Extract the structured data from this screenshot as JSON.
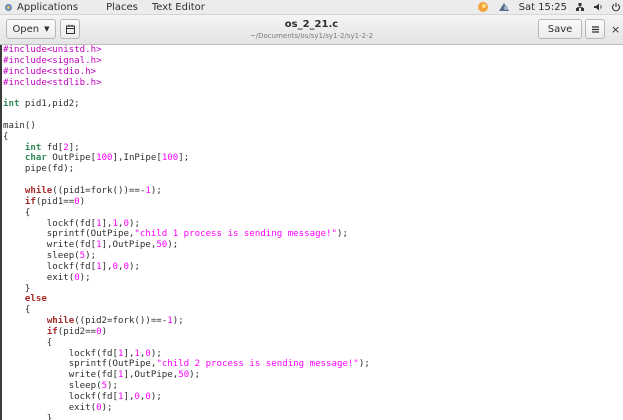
{
  "topbar": {
    "applications": "Applications",
    "places": "Places",
    "text_editor": "Text Editor",
    "clock": "Sat 15:25"
  },
  "header": {
    "open_label": "Open",
    "title": "os_2_21.c",
    "subtitle": "~/Documents/os/sy1/sy1-2/sy1-2-2",
    "save_label": "Save"
  },
  "icons": {
    "applications": "applications-icon",
    "weather": "weather-icon",
    "accessibility": "accessibility-icon",
    "network": "network-icon",
    "volume": "volume-icon",
    "power": "power-icon",
    "new_document": "new-document-icon",
    "menu": "hamburger-menu-icon",
    "close": "close-icon"
  },
  "colors": {
    "preprocessor": "#c000c0",
    "keyword": "#a52a2a",
    "type": "#2e8b57",
    "literal": "#ff00ff"
  },
  "code_lines": [
    [
      {
        "t": "pp",
        "v": "#include<unistd.h>"
      }
    ],
    [
      {
        "t": "pp",
        "v": "#include<signal.h>"
      }
    ],
    [
      {
        "t": "pp",
        "v": "#include<stdio.h>"
      }
    ],
    [
      {
        "t": "pp",
        "v": "#include<stdlib.h>"
      }
    ],
    [],
    [
      {
        "t": "ty",
        "v": "int"
      },
      {
        "t": "id",
        "v": " pid1,pid2;"
      }
    ],
    [],
    [
      {
        "t": "id",
        "v": "main()"
      }
    ],
    [
      {
        "t": "id",
        "v": "{"
      }
    ],
    [
      {
        "t": "id",
        "v": "    "
      },
      {
        "t": "ty",
        "v": "int"
      },
      {
        "t": "id",
        "v": " fd["
      },
      {
        "t": "num",
        "v": "2"
      },
      {
        "t": "id",
        "v": "];"
      }
    ],
    [
      {
        "t": "id",
        "v": "    "
      },
      {
        "t": "ty",
        "v": "char"
      },
      {
        "t": "id",
        "v": " OutPipe["
      },
      {
        "t": "num",
        "v": "100"
      },
      {
        "t": "id",
        "v": "],InPipe["
      },
      {
        "t": "num",
        "v": "100"
      },
      {
        "t": "id",
        "v": "];"
      }
    ],
    [
      {
        "t": "id",
        "v": "    pipe(fd);"
      }
    ],
    [],
    [
      {
        "t": "id",
        "v": "    "
      },
      {
        "t": "kw",
        "v": "while"
      },
      {
        "t": "id",
        "v": "((pid1=fork())==-"
      },
      {
        "t": "num",
        "v": "1"
      },
      {
        "t": "id",
        "v": ");"
      }
    ],
    [
      {
        "t": "id",
        "v": "    "
      },
      {
        "t": "kw",
        "v": "if"
      },
      {
        "t": "id",
        "v": "(pid1=="
      },
      {
        "t": "num",
        "v": "0"
      },
      {
        "t": "id",
        "v": ")"
      }
    ],
    [
      {
        "t": "id",
        "v": "    {"
      }
    ],
    [
      {
        "t": "id",
        "v": "        lockf(fd["
      },
      {
        "t": "num",
        "v": "1"
      },
      {
        "t": "id",
        "v": "],"
      },
      {
        "t": "num",
        "v": "1"
      },
      {
        "t": "id",
        "v": ","
      },
      {
        "t": "num",
        "v": "0"
      },
      {
        "t": "id",
        "v": ");"
      }
    ],
    [
      {
        "t": "id",
        "v": "        sprintf(OutPipe,"
      },
      {
        "t": "str",
        "v": "\"child 1 process is sending message!\""
      },
      {
        "t": "id",
        "v": ");"
      }
    ],
    [
      {
        "t": "id",
        "v": "        write(fd["
      },
      {
        "t": "num",
        "v": "1"
      },
      {
        "t": "id",
        "v": "],OutPipe,"
      },
      {
        "t": "num",
        "v": "50"
      },
      {
        "t": "id",
        "v": ");"
      }
    ],
    [
      {
        "t": "id",
        "v": "        sleep("
      },
      {
        "t": "num",
        "v": "5"
      },
      {
        "t": "id",
        "v": ");"
      }
    ],
    [
      {
        "t": "id",
        "v": "        lockf(fd["
      },
      {
        "t": "num",
        "v": "1"
      },
      {
        "t": "id",
        "v": "],"
      },
      {
        "t": "num",
        "v": "0"
      },
      {
        "t": "id",
        "v": ","
      },
      {
        "t": "num",
        "v": "0"
      },
      {
        "t": "id",
        "v": ");"
      }
    ],
    [
      {
        "t": "id",
        "v": "        exit("
      },
      {
        "t": "num",
        "v": "0"
      },
      {
        "t": "id",
        "v": ");"
      }
    ],
    [
      {
        "t": "id",
        "v": "    }"
      }
    ],
    [
      {
        "t": "id",
        "v": "    "
      },
      {
        "t": "kw",
        "v": "else"
      }
    ],
    [
      {
        "t": "id",
        "v": "    {"
      }
    ],
    [
      {
        "t": "id",
        "v": "        "
      },
      {
        "t": "kw",
        "v": "while"
      },
      {
        "t": "id",
        "v": "((pid2=fork())==-"
      },
      {
        "t": "num",
        "v": "1"
      },
      {
        "t": "id",
        "v": ");"
      }
    ],
    [
      {
        "t": "id",
        "v": "        "
      },
      {
        "t": "kw",
        "v": "if"
      },
      {
        "t": "id",
        "v": "(pid2=="
      },
      {
        "t": "num",
        "v": "0"
      },
      {
        "t": "id",
        "v": ")"
      }
    ],
    [
      {
        "t": "id",
        "v": "        {"
      }
    ],
    [
      {
        "t": "id",
        "v": "            lockf(fd["
      },
      {
        "t": "num",
        "v": "1"
      },
      {
        "t": "id",
        "v": "],"
      },
      {
        "t": "num",
        "v": "1"
      },
      {
        "t": "id",
        "v": ","
      },
      {
        "t": "num",
        "v": "0"
      },
      {
        "t": "id",
        "v": ");"
      }
    ],
    [
      {
        "t": "id",
        "v": "            sprintf(OutPipe,"
      },
      {
        "t": "str",
        "v": "\"child 2 process is sending message!\""
      },
      {
        "t": "id",
        "v": ");"
      }
    ],
    [
      {
        "t": "id",
        "v": "            write(fd["
      },
      {
        "t": "num",
        "v": "1"
      },
      {
        "t": "id",
        "v": "],OutPipe,"
      },
      {
        "t": "num",
        "v": "50"
      },
      {
        "t": "id",
        "v": ");"
      }
    ],
    [
      {
        "t": "id",
        "v": "            sleep("
      },
      {
        "t": "num",
        "v": "5"
      },
      {
        "t": "id",
        "v": ");"
      }
    ],
    [
      {
        "t": "id",
        "v": "            lockf(fd["
      },
      {
        "t": "num",
        "v": "1"
      },
      {
        "t": "id",
        "v": "],"
      },
      {
        "t": "num",
        "v": "0"
      },
      {
        "t": "id",
        "v": ","
      },
      {
        "t": "num",
        "v": "0"
      },
      {
        "t": "id",
        "v": ");"
      }
    ],
    [
      {
        "t": "id",
        "v": "            exit("
      },
      {
        "t": "num",
        "v": "0"
      },
      {
        "t": "id",
        "v": ");"
      }
    ],
    [
      {
        "t": "id",
        "v": "        }"
      }
    ]
  ]
}
